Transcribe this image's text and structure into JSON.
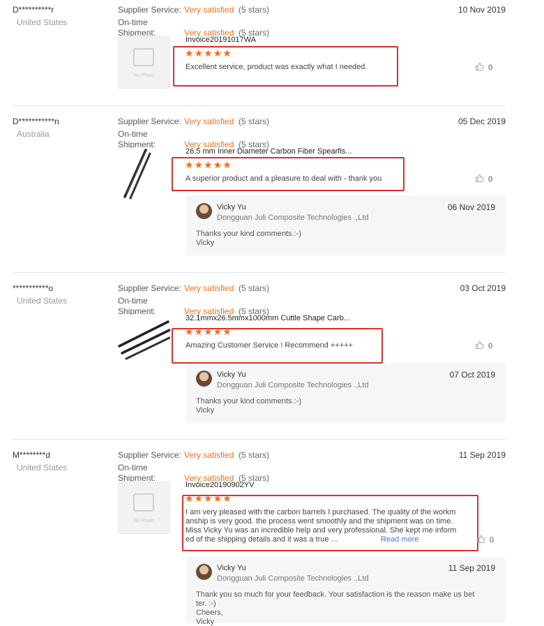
{
  "labels": {
    "supplier_service": "Supplier Service:",
    "on_time": "On-time",
    "shipment": "Shipment:",
    "no_photo": "No Photo",
    "read_more": "Read more"
  },
  "colors": {
    "accent": "#e8711c",
    "star": "#f26b1d",
    "highlight_box": "#d9302c",
    "link": "#3a7bd5"
  },
  "icons": {
    "like": "thumbs-up-icon",
    "star": "star-icon",
    "no_photo": "image-placeholder-icon"
  },
  "reviews": [
    {
      "buyer": "D**********r",
      "country": "United States",
      "date": "10 Nov 2019",
      "supplier_rating": "Very satisfied",
      "supplier_stars": "(5 stars)",
      "shipment_rating": "Very satisfied",
      "shipment_stars": "(5 stars)",
      "product": "Invoice20191017WA",
      "rating_stars": 5,
      "comment": "Excellent service, product was exactly what I needed.",
      "likes": "0"
    },
    {
      "buyer": "D***********n",
      "country": "Australia",
      "date": "05 Dec 2019",
      "supplier_rating": "Very satisfied",
      "supplier_stars": "(5 stars)",
      "shipment_rating": "Very satisfied",
      "shipment_stars": "(5 stars)",
      "product": "26.5 mm Inner Diameter Carbon Fiber Spearfis...",
      "rating_stars": 5,
      "comment": "A superior product and a pleasure to deal with - thank you",
      "likes": "0",
      "reply": {
        "name": "Vicky Yu",
        "company": "Dongguan Juli Composite Technologies .,Ltd",
        "date": "06 Nov 2019",
        "text_lines": [
          "Thanks your kind comments.:-)",
          "Vicky"
        ]
      }
    },
    {
      "buyer": "***********o",
      "country": "United States",
      "date": "03 Oct 2019",
      "supplier_rating": "Very satisfied",
      "supplier_stars": "(5 stars)",
      "shipment_rating": "Very satisfied",
      "shipment_stars": "(5 stars)",
      "product": "32.1mmx26.5mmx1000mm Cuttle Shape Carb...",
      "rating_stars": 5,
      "comment": "Amazing Customer Service ! Recommend +++++",
      "likes": "0",
      "reply": {
        "name": "Vicky Yu",
        "company": "Dongguan Juli Composite Technologies .,Ltd",
        "date": "07 Oct 2019",
        "text_lines": [
          "Thanks your kind comments.:-)",
          "Vicky"
        ]
      }
    },
    {
      "buyer": "M********d",
      "country": "United States",
      "date": "11 Sep 2019",
      "supplier_rating": "Very satisfied",
      "supplier_stars": "(5 stars)",
      "shipment_rating": "Very satisfied",
      "shipment_stars": "(5 stars)",
      "product": "Invoice20190902YV",
      "rating_stars": 5,
      "comment_lines": [
        "I am very pleased with the carbon barrels I purchased.  The quality of the workm",
        "anship is very good. the process went smoothly and the shipment was on time.",
        "Miss Vicky Yu was an incredible help and very professional. She kept me inform",
        "ed of the shipping details and it was a true ..."
      ],
      "likes": "0",
      "reply": {
        "name": "Vicky Yu",
        "company": "Dongguan Juli Composite Technologies .,Ltd",
        "date": "11 Sep 2019",
        "text_lines": [
          "Thank you so much for your feedback. Your satisfaction is the reason make us bet",
          "ter. :-)",
          "Cheers,",
          "Vicky"
        ]
      }
    }
  ]
}
